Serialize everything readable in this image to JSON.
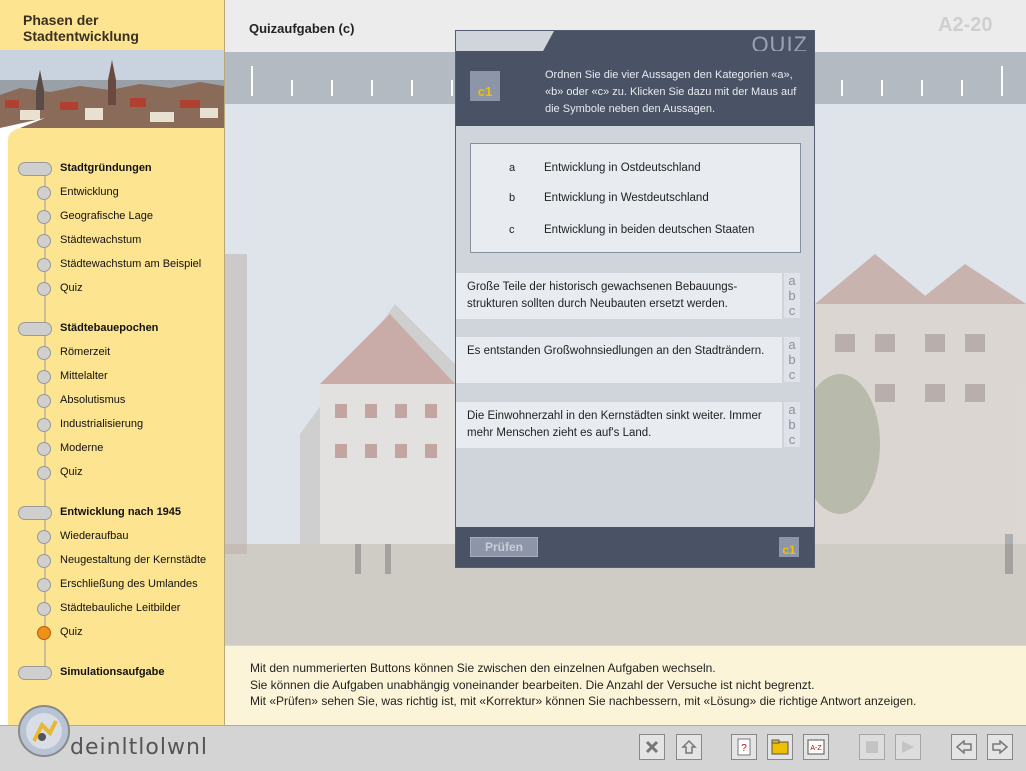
{
  "app": {
    "title": "Phasen der Stadtentwicklung",
    "page_number": "A2-20",
    "screen_title": "Quizaufgaben (c)"
  },
  "sidebar": {
    "sections": [
      {
        "label": "Stadtgründungen",
        "items": [
          "Entwicklung",
          "Geografische Lage",
          "Städtewachstum",
          "Städtewachstum am Beispiel",
          "Quiz"
        ]
      },
      {
        "label": "Städtebauepochen",
        "items": [
          "Römerzeit",
          "Mittelalter",
          "Absolutismus",
          "Industrialisierung",
          "Moderne",
          "Quiz"
        ]
      },
      {
        "label": "Entwicklung nach 1945",
        "items": [
          "Wiederaufbau",
          "Neugestaltung der Kernstädte",
          "Erschließung des Umlandes",
          "Städtebauliche Leitbilder",
          "Quiz"
        ]
      },
      {
        "label": "Simulationsaufgabe",
        "items": []
      }
    ],
    "active_item": "Entwicklung nach 1945 / Quiz"
  },
  "quiz": {
    "label": "QUIZ",
    "task_id": "c1",
    "instruction": "Ordnen Sie die vier Aussagen den Kategorien «a», «b» oder «c» zu. Klicken Sie dazu mit der Maus auf die Symbole neben den Aussagen.",
    "categories": [
      {
        "key": "a",
        "text": "Entwicklung in Ostdeutschland"
      },
      {
        "key": "b",
        "text": "Entwicklung in Westdeutschland"
      },
      {
        "key": "c",
        "text": "Entwicklung in beiden deutschen Staaten"
      }
    ],
    "statements": [
      "Große Teile der historisch gewachsenen Bebauungs-strukturen sollten durch Neubauten ersetzt werden.",
      "Es entstanden Großwohnsiedlungen an den Stadträndern.",
      "Die Einwohnerzahl in den Kernstädten sinkt weiter. Immer mehr Menschen zieht es auf's Land."
    ],
    "options": [
      "a",
      "b",
      "c"
    ],
    "check_button": "Prüfen",
    "footer_task_id": "c1"
  },
  "info": {
    "lines": [
      "Mit den nummerierten Buttons können Sie zwischen den einzelnen Aufgaben wechseln.",
      "Sie können die Aufgaben unabhängig voneinander bearbeiten. Die Anzahl der Versuche ist nicht begrenzt.",
      "Mit «Prüfen» sehen Sie, was richtig ist, mit «Korrektur» können Sie nachbessern, mit «Lösung» die richtige Antwort anzeigen."
    ]
  },
  "toolbar": {
    "logo_text": "deinltlolwnl",
    "buttons": [
      "close-icon",
      "home-icon",
      "help-icon",
      "folder-icon",
      "glossary-icon",
      "stop-icon",
      "play-icon",
      "back-icon",
      "forward-icon"
    ]
  }
}
